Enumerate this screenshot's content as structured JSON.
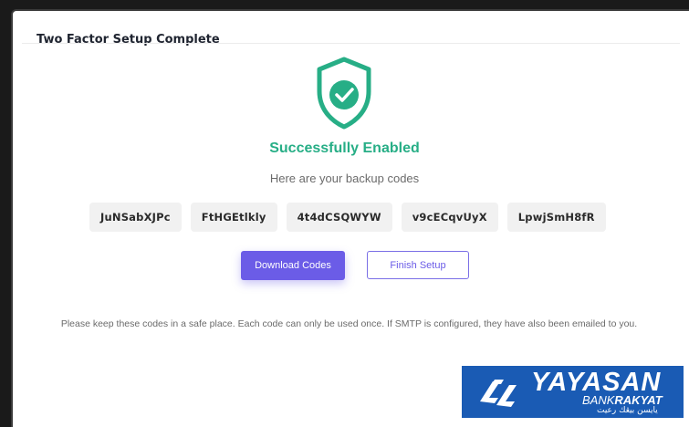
{
  "card": {
    "title": "Two Factor Setup Complete"
  },
  "status": {
    "icon": "shield-check-icon",
    "title": "Successfully Enabled",
    "subtitle": "Here are your backup codes"
  },
  "backup_codes": [
    "JuNSabXJPc",
    "FtHGEtlkly",
    "4t4dCSQWYW",
    "v9cECqvUyX",
    "LpwjSmH8fR"
  ],
  "actions": {
    "download_label": "Download Codes",
    "finish_label": "Finish Setup"
  },
  "notice": "Please keep these codes in a safe place. Each code can only be used once. If SMTP is configured, they have also been emailed to you.",
  "logo": {
    "name": "YAYASAN",
    "sub_prefix": "BANK",
    "sub_bold": "RAKYAT",
    "jawi": "يايسن بيڠك رعيت"
  },
  "colors": {
    "accent": "#6b5ce7",
    "success": "#27ae86",
    "logo_bg": "#1a5bb4"
  }
}
